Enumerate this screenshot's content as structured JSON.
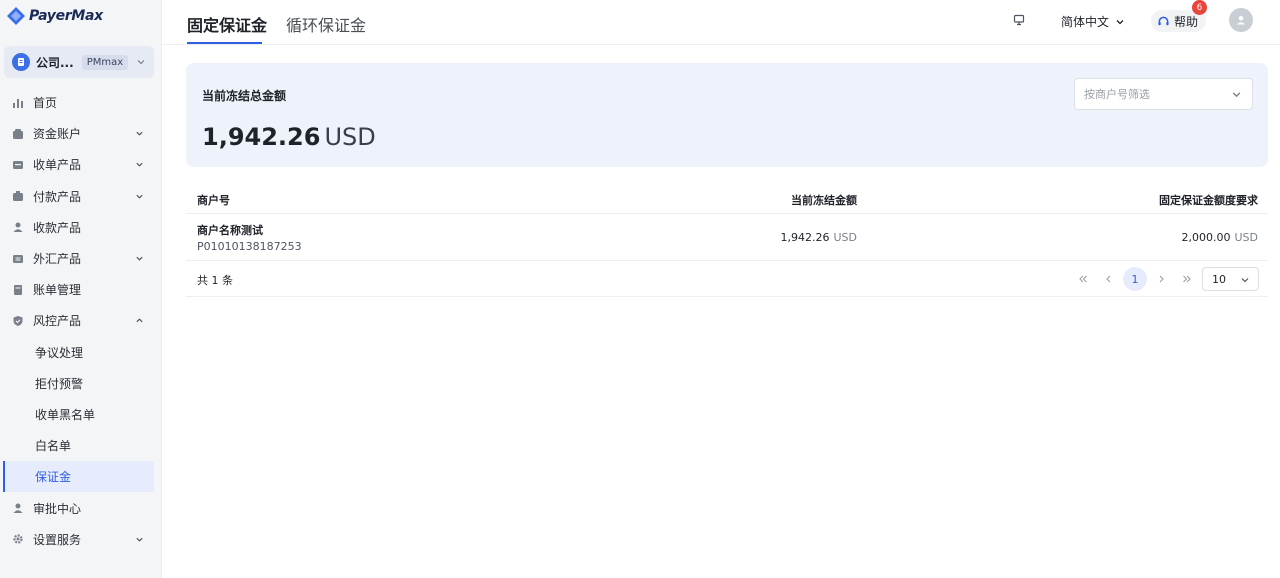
{
  "brand": {
    "name": "PayerMax"
  },
  "company": {
    "name": "公司...",
    "tag": "PMmax"
  },
  "sidebar": {
    "items": [
      {
        "label": "首页",
        "icon": "bar-chart-icon"
      },
      {
        "label": "资金账户",
        "icon": "wallet-icon"
      },
      {
        "label": "收单产品",
        "icon": "card-icon"
      },
      {
        "label": "付款产品",
        "icon": "payment-icon"
      },
      {
        "label": "收款产品",
        "icon": "user-icon"
      },
      {
        "label": "外汇产品",
        "icon": "exchange-icon"
      },
      {
        "label": "账单管理",
        "icon": "bill-icon"
      },
      {
        "label": "风控产品",
        "icon": "shield-icon"
      }
    ],
    "risk_sub": [
      "争议处理",
      "拒付预警",
      "收单黑名单",
      "白名单",
      "保证金"
    ],
    "tail_items": [
      {
        "label": "审批中心",
        "icon": "user-icon"
      },
      {
        "label": "设置服务",
        "icon": "gear-icon"
      }
    ]
  },
  "header": {
    "tabs": [
      "固定保证金",
      "循环保证金"
    ],
    "language": "简体中文",
    "help": "帮助",
    "help_badge": "6"
  },
  "summary": {
    "title": "当前冻结总金额",
    "amount": "1,942.26",
    "currency": "USD",
    "filter_placeholder": "按商户号筛选"
  },
  "table": {
    "columns": [
      "商户号",
      "当前冻结金额",
      "固定保证金额度要求"
    ],
    "rows": [
      {
        "merchant_name": "商户名称测试",
        "merchant_id": "P01010138187253",
        "frozen_amount": "1,942.26",
        "frozen_currency": "USD",
        "required_amount": "2,000.00",
        "required_currency": "USD"
      }
    ],
    "total_text": "共 1 条",
    "current_page": "1",
    "page_size": "10"
  },
  "colors": {
    "accent": "#2f5fe0",
    "badge": "#e8453c",
    "summary_bg": "#eef2fa"
  }
}
